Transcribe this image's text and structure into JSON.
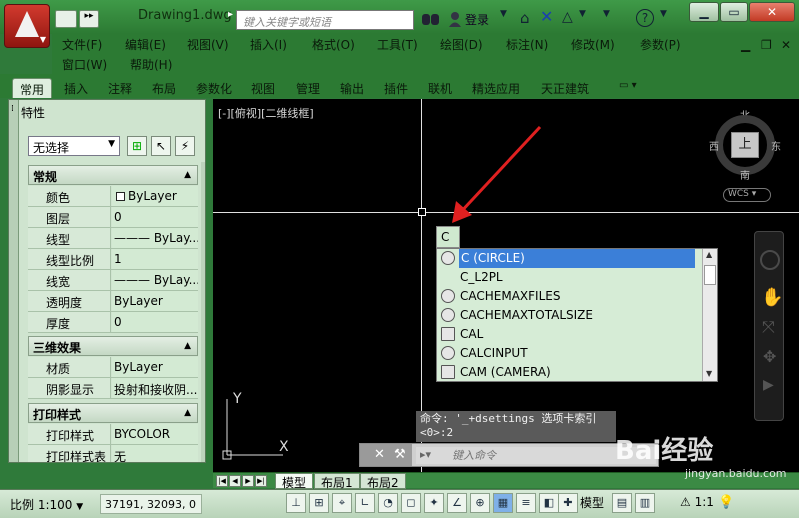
{
  "titlebar": {
    "doc_title": "Drawing1.dwg",
    "search_placeholder": "键入关键字或短语",
    "login": "登录"
  },
  "menu": {
    "row1": [
      "文件(F)",
      "编辑(E)",
      "视图(V)",
      "插入(I)",
      "格式(O)",
      "工具(T)",
      "绘图(D)",
      "标注(N)",
      "修改(M)",
      "参数(P)"
    ],
    "row2": [
      "窗口(W)",
      "帮助(H)"
    ]
  },
  "ribbon_tabs": [
    "常用",
    "插入",
    "注释",
    "布局",
    "参数化",
    "视图",
    "管理",
    "输出",
    "插件",
    "联机",
    "精选应用",
    "天正建筑"
  ],
  "properties": {
    "title": "特性",
    "selection": "无选择",
    "sections": [
      {
        "title": "常规",
        "rows": [
          {
            "label": "颜色",
            "value": "ByLayer"
          },
          {
            "label": "图层",
            "value": "0"
          },
          {
            "label": "线型",
            "value": "——— ByLay..."
          },
          {
            "label": "线型比例",
            "value": "1"
          },
          {
            "label": "线宽",
            "value": "——— ByLay..."
          },
          {
            "label": "透明度",
            "value": "ByLayer"
          },
          {
            "label": "厚度",
            "value": "0"
          }
        ]
      },
      {
        "title": "三维效果",
        "rows": [
          {
            "label": "材质",
            "value": "ByLayer"
          },
          {
            "label": "阴影显示",
            "value": "投射和接收阴..."
          }
        ]
      },
      {
        "title": "打印样式",
        "rows": [
          {
            "label": "打印样式",
            "value": "BYCOLOR"
          },
          {
            "label": "打印样式表",
            "value": "无"
          }
        ]
      }
    ]
  },
  "viewport": {
    "label": "[-][俯视][二维线框]",
    "viewcube": {
      "top": "上",
      "north": "北",
      "south": "南",
      "east": "东",
      "west": "西"
    },
    "wcs": "WCS"
  },
  "autocomplete": {
    "input": "C",
    "items": [
      "C (CIRCLE)",
      "C_L2PL",
      "CACHEMAXFILES",
      "CACHEMAXTOTALSIZE",
      "CAL",
      "CALCINPUT",
      "CAM (CAMERA)"
    ],
    "selected_index": 0
  },
  "command": {
    "history": [
      "命令: '_+dsettings 选项卡索引",
      "<0>:2"
    ],
    "placeholder": "键入命令"
  },
  "layout_tabs": [
    "模型",
    "布局1",
    "布局2"
  ],
  "statusbar": {
    "scale": "比例 1:100",
    "coords": "37191, 32093, 0",
    "model": "模型",
    "anno_scale": "1:1"
  },
  "ucs": {
    "x": "X",
    "y": "Y"
  },
  "watermark": "Bai经验",
  "watermark_sub": "jingyan.baidu.com",
  "colors": {
    "accent_green": "#2c7a33",
    "selection_blue": "#3b7fd8",
    "arrow_red": "#e02020"
  }
}
